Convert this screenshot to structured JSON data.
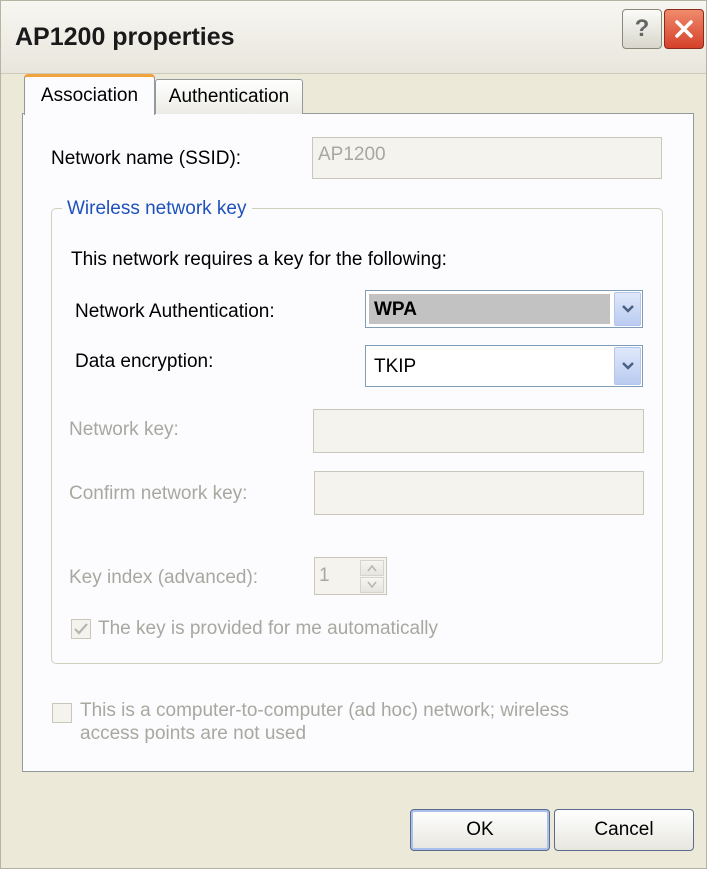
{
  "window": {
    "title": "AP1200 properties"
  },
  "tabs": [
    {
      "label": "Association"
    },
    {
      "label": "Authentication"
    }
  ],
  "association": {
    "ssid_label": "Network name (SSID):",
    "ssid_value": "AP1200",
    "group_title": "Wireless network key",
    "requires_text": "This network requires a key for the following:",
    "net_auth_label": "Network Authentication:",
    "net_auth_value": "WPA",
    "data_enc_label": "Data encryption:",
    "data_enc_value": "TKIP",
    "net_key_label": "Network key:",
    "confirm_key_label": "Confirm network key:",
    "key_index_label": "Key index (advanced):",
    "key_index_value": "1",
    "auto_key_label": "The key is provided for me automatically",
    "adhoc_line1": "This is a computer-to-computer (ad hoc) network; wireless",
    "adhoc_line2": "access points are not used"
  },
  "buttons": {
    "ok": "OK",
    "cancel": "Cancel"
  }
}
